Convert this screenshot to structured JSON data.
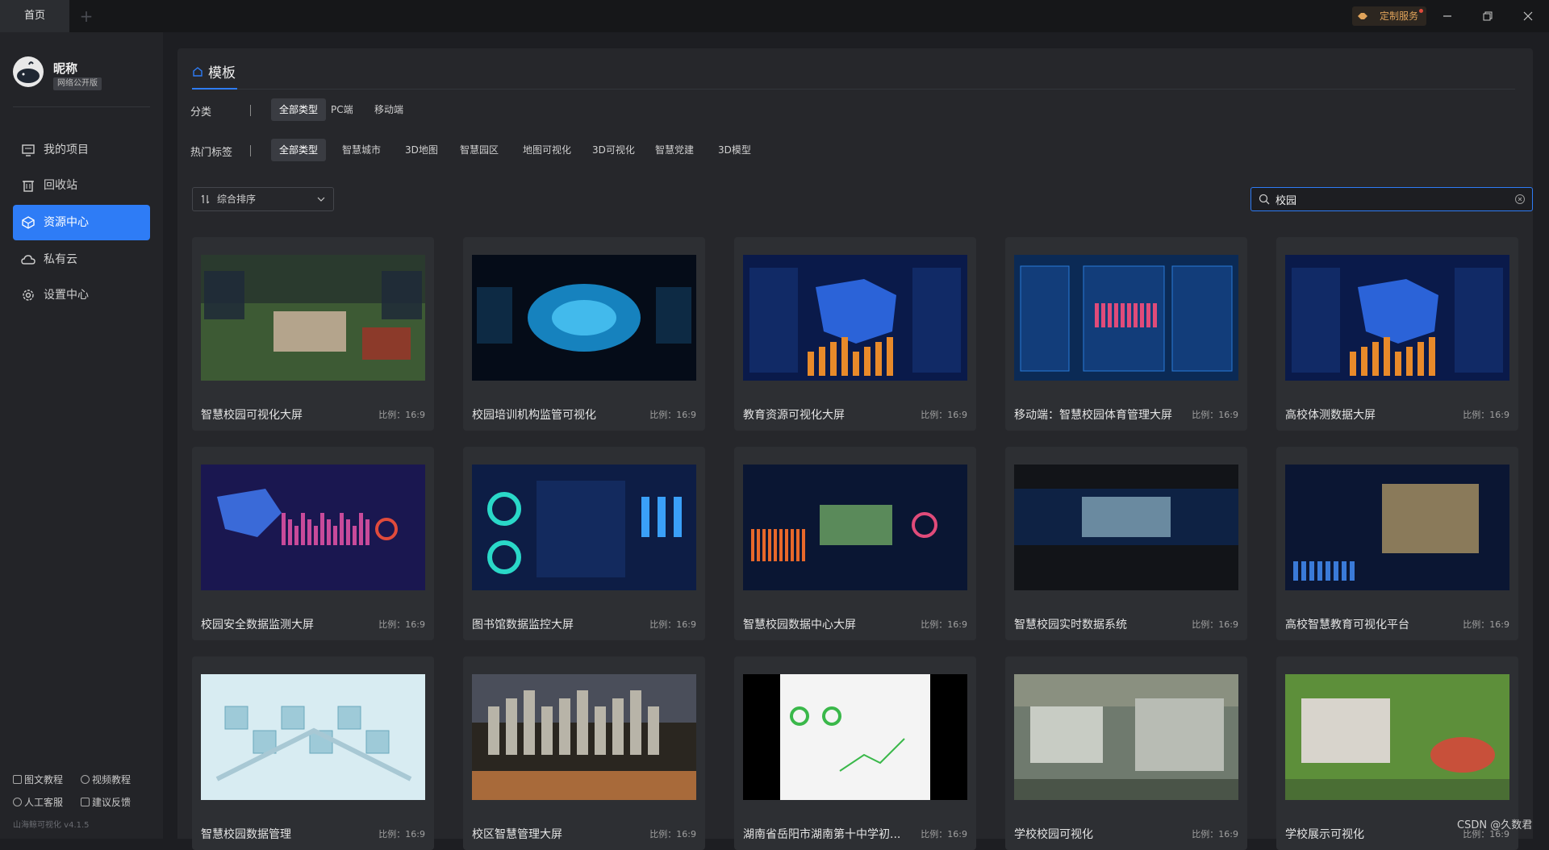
{
  "titlebar": {
    "home_tab": "首页",
    "add_tab": "+",
    "custom_service": "定制服务"
  },
  "sidebar": {
    "nickname": "昵称",
    "edition": "网络公开版",
    "nav": [
      {
        "label": "我的项目",
        "icon": "projects-icon",
        "active": false
      },
      {
        "label": "回收站",
        "icon": "trash-icon",
        "active": false
      },
      {
        "label": "资源中心",
        "icon": "cube-icon",
        "active": true
      },
      {
        "label": "私有云",
        "icon": "cloud-icon",
        "active": false
      },
      {
        "label": "设置中心",
        "icon": "gear-icon",
        "active": false
      }
    ],
    "footer": {
      "doc_tutorial": "图文教程",
      "video_tutorial": "视频教程",
      "support": "人工客服",
      "feedback": "建议反馈"
    },
    "version": "山海鲸可视化 v4.1.5"
  },
  "panel": {
    "title": "模板",
    "category_label": "分类",
    "categories": [
      "全部类型",
      "PC端",
      "移动端"
    ],
    "hot_tags_label": "热门标签",
    "hot_tags": [
      "全部类型",
      "智慧城市",
      "3D地图",
      "智慧园区",
      "地图可视化",
      "3D可视化",
      "智慧党建",
      "3D模型"
    ],
    "sort": "综合排序",
    "search_value": "校园"
  },
  "templates": [
    {
      "title": "智慧校园可视化大屏",
      "ratio": "比例：16:9",
      "style": "aerial"
    },
    {
      "title": "校园培训机构监管可视化",
      "ratio": "比例：16:9",
      "style": "map-glow"
    },
    {
      "title": "教育资源可视化大屏",
      "ratio": "比例：16:9",
      "style": "map-blue"
    },
    {
      "title": "移动端：智慧校园体育管理大屏",
      "ratio": "比例：16:9",
      "style": "mobile"
    },
    {
      "title": "高校体测数据大屏",
      "ratio": "比例：16:9",
      "style": "map-blue"
    },
    {
      "title": "校园安全数据监测大屏",
      "ratio": "比例：16:9",
      "style": "map-purple"
    },
    {
      "title": "图书馆数据监控大屏",
      "ratio": "比例：16:9",
      "style": "rings"
    },
    {
      "title": "智慧校园数据中心大屏",
      "ratio": "比例：16:9",
      "style": "center-photo"
    },
    {
      "title": "智慧校园实时数据系统",
      "ratio": "比例：16:9",
      "style": "strip"
    },
    {
      "title": "高校智慧教育可视化平台",
      "ratio": "比例：16:9",
      "style": "photo-grid"
    },
    {
      "title": "智慧校园数据管理",
      "ratio": "比例：16:9",
      "style": "iso-light"
    },
    {
      "title": "校区智慧管理大屏",
      "ratio": "比例：16:9",
      "style": "city"
    },
    {
      "title": "湖南省岳阳市湖南第十中学初...",
      "ratio": "比例：16:9",
      "style": "white-doc"
    },
    {
      "title": "学校校园可视化",
      "ratio": "比例：16:9",
      "style": "campus-3d"
    },
    {
      "title": "学校展示可视化",
      "ratio": "比例：16:9",
      "style": "campus-3d-green"
    }
  ],
  "watermark": "CSDN @久数君"
}
